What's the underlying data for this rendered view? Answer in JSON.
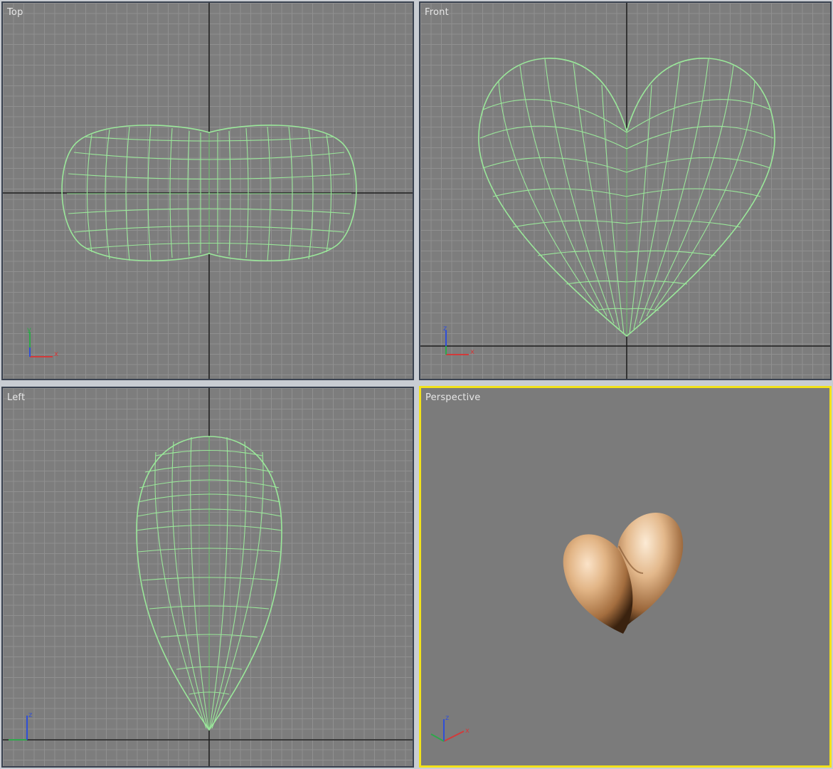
{
  "viewports": {
    "top": {
      "label": "Top"
    },
    "front": {
      "label": "Front"
    },
    "left": {
      "label": "Left"
    },
    "perspective": {
      "label": "Perspective",
      "active": true
    }
  },
  "gizmo": {
    "x_label": "x",
    "y_label": "y",
    "z_label": "z"
  },
  "colors": {
    "viewport_bg": "#7d7d7d",
    "grid_line": "#909090",
    "wireframe": "#9ae89a",
    "active_border": "#f2e21a",
    "inactive_border": "#3a4250",
    "model_skin": "#d9a878",
    "axis_x": "#d23a3a",
    "axis_y": "#2ea84a",
    "axis_z": "#2f4fd8"
  }
}
